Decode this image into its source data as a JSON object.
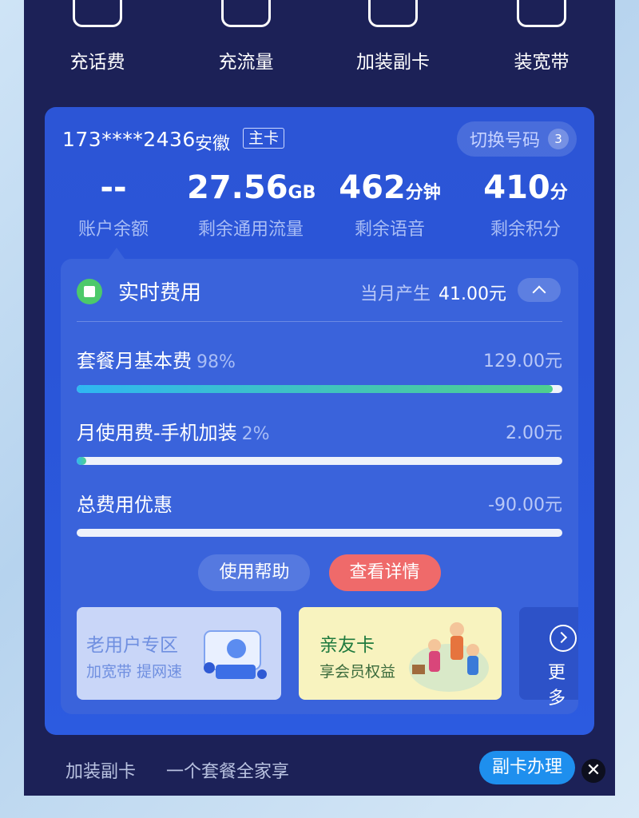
{
  "quick_actions": [
    {
      "label": "充话费",
      "icon": "phone-recharge-icon"
    },
    {
      "label": "充流量",
      "icon": "data-recharge-icon"
    },
    {
      "label": "加装副卡",
      "icon": "sim-card-icon"
    },
    {
      "label": "装宽带",
      "icon": "broadband-icon"
    }
  ],
  "account": {
    "phone": "173****2436",
    "province": "安徽",
    "card_tag": "主卡",
    "switch_label": "切换号码",
    "switch_count": "3"
  },
  "stats": [
    {
      "value": "--",
      "unit": "",
      "label": "账户余额"
    },
    {
      "value": "27.56",
      "unit": "GB",
      "label": "剩余通用流量"
    },
    {
      "value": "462",
      "unit": "分钟",
      "label": "剩余语音"
    },
    {
      "value": "410",
      "unit": "分",
      "label": "剩余积分"
    }
  ],
  "fees": {
    "title": "实时费用",
    "month_label": "当月产生",
    "month_amount": "41.00元",
    "items": [
      {
        "name": "套餐月基本费",
        "percent": "98%",
        "amount": "129.00元",
        "fill": 0.98
      },
      {
        "name": "月使用费-手机加装",
        "percent": "2%",
        "amount": "2.00元",
        "fill": 0.02
      },
      {
        "name": "总费用优惠",
        "percent": "",
        "amount": "-90.00元",
        "fill": 0
      }
    ],
    "help_label": "使用帮助",
    "detail_label": "查看详情"
  },
  "promos": [
    {
      "title": "老用户专区",
      "subtitle": "加宽带 提网速"
    },
    {
      "title": "亲友卡",
      "subtitle": "享会员权益"
    }
  ],
  "more_label": "更多",
  "bottom_bar": {
    "label": "加装副卡",
    "subtitle": "一个套餐全家享",
    "button": "副卡办理",
    "close": "✕"
  },
  "colors": {
    "accent": "#2c55d6",
    "detail": "#ef6a6a",
    "bar_start": "#2fb7f2",
    "bar_end": "#4fcf8d",
    "bottom_button": "#1e8fee"
  }
}
